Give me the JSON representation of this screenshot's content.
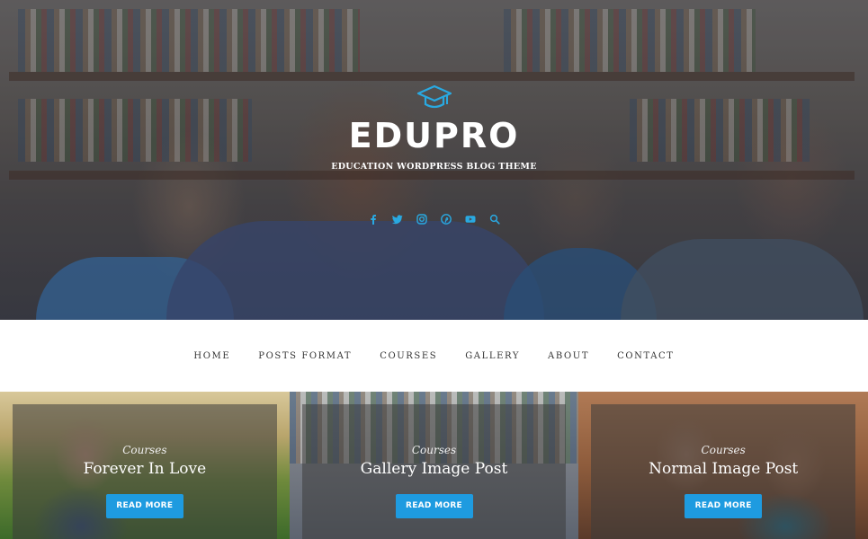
{
  "site": {
    "title": "EDUPRO",
    "tagline": "EDUCATION WORDPRESS BLOG THEME"
  },
  "social": [
    {
      "name": "facebook",
      "icon": "facebook-icon"
    },
    {
      "name": "twitter",
      "icon": "twitter-icon"
    },
    {
      "name": "instagram",
      "icon": "instagram-icon"
    },
    {
      "name": "pinterest",
      "icon": "pinterest-icon"
    },
    {
      "name": "youtube",
      "icon": "youtube-icon"
    },
    {
      "name": "search",
      "icon": "search-icon"
    }
  ],
  "nav": {
    "items": [
      {
        "label": "HOME"
      },
      {
        "label": "POSTS FORMAT"
      },
      {
        "label": "COURSES"
      },
      {
        "label": "GALLERY"
      },
      {
        "label": "ABOUT"
      },
      {
        "label": "CONTACT"
      }
    ]
  },
  "cards": [
    {
      "category": "Courses",
      "title": "Forever In Love",
      "button": "READ MORE"
    },
    {
      "category": "Courses",
      "title": "Gallery Image Post",
      "button": "READ MORE"
    },
    {
      "category": "Courses",
      "title": "Normal Image Post",
      "button": "READ MORE"
    }
  ],
  "colors": {
    "accent": "#1e9be0",
    "social": "#29a9e1",
    "nav_text": "#333333"
  }
}
